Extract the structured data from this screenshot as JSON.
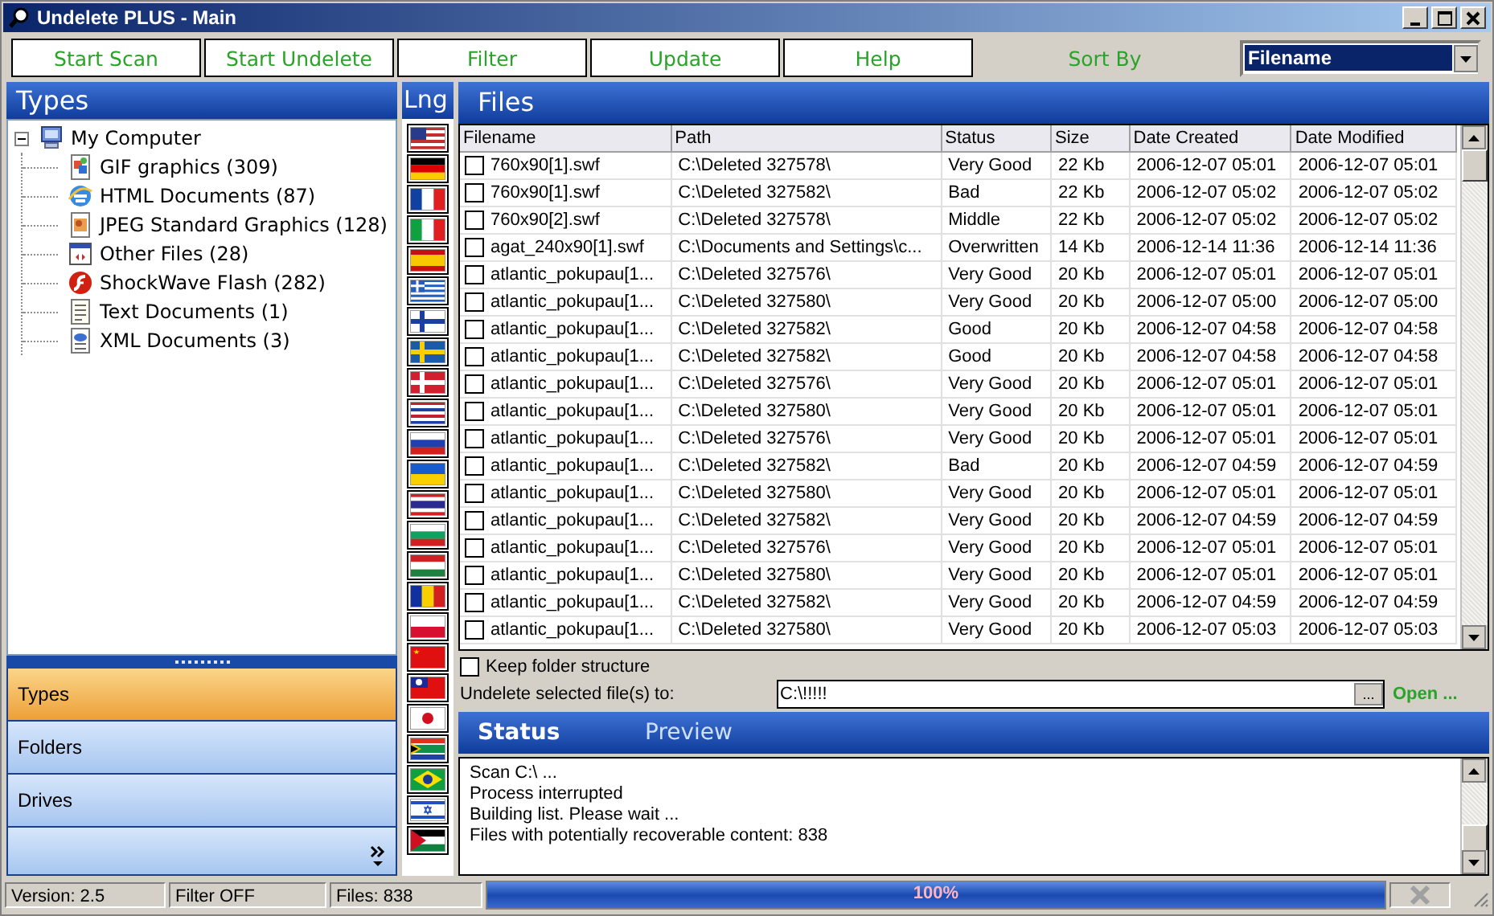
{
  "window": {
    "title": "Undelete PLUS - Main"
  },
  "toolbar": {
    "buttons": [
      "Start Scan",
      "Start Undelete",
      "Filter",
      "Update",
      "Help"
    ],
    "sort_label": "Sort By",
    "sort_value": "Filename"
  },
  "types_panel": {
    "title": "Types",
    "tree": [
      {
        "label": "My Computer",
        "kind": "computer",
        "expanded": true,
        "children": [
          {
            "label": "GIF graphics (309)",
            "kind": "gif"
          },
          {
            "label": "HTML Documents (87)",
            "kind": "html"
          },
          {
            "label": "JPEG Standard Graphics (128)",
            "kind": "jpeg"
          },
          {
            "label": "Other Files (28)",
            "kind": "other"
          },
          {
            "label": "ShockWave Flash (282)",
            "kind": "flash"
          },
          {
            "label": "Text Documents (1)",
            "kind": "text"
          },
          {
            "label": "XML Documents (3)",
            "kind": "xml"
          }
        ]
      }
    ]
  },
  "nav": [
    {
      "label": "Types",
      "selected": true
    },
    {
      "label": "Folders",
      "selected": false
    },
    {
      "label": "Drives",
      "selected": false
    }
  ],
  "languages": {
    "title": "Lng",
    "flags": [
      {
        "kind": "usa"
      },
      {
        "kind": "germany"
      },
      {
        "kind": "france"
      },
      {
        "kind": "italy"
      },
      {
        "kind": "spain"
      },
      {
        "kind": "greece"
      },
      {
        "kind": "finland"
      },
      {
        "kind": "sweden"
      },
      {
        "kind": "denmark"
      },
      {
        "kind": "netherlands"
      },
      {
        "kind": "russia"
      },
      {
        "kind": "ukraine"
      },
      {
        "kind": "thailand"
      },
      {
        "kind": "bulgaria"
      },
      {
        "kind": "hungary"
      },
      {
        "kind": "romania"
      },
      {
        "kind": "poland"
      },
      {
        "kind": "china"
      },
      {
        "kind": "taiwan"
      },
      {
        "kind": "japan"
      },
      {
        "kind": "southafrica"
      },
      {
        "kind": "brazil"
      },
      {
        "kind": "israel"
      },
      {
        "kind": "jordan"
      }
    ]
  },
  "files": {
    "title": "Files",
    "columns": [
      "Filename",
      "Path",
      "Status",
      "Size",
      "Date Created",
      "Date Modified"
    ],
    "rows": [
      {
        "checked": false,
        "cells": [
          "760x90[1].swf",
          "C:\\Deleted 327578\\",
          "Very Good",
          "22 Kb",
          "2006-12-07 05:01",
          "2006-12-07 05:01"
        ]
      },
      {
        "checked": false,
        "cells": [
          "760x90[1].swf",
          "C:\\Deleted 327582\\",
          "Bad",
          "22 Kb",
          "2006-12-07 05:02",
          "2006-12-07 05:02"
        ]
      },
      {
        "checked": false,
        "cells": [
          "760x90[2].swf",
          "C:\\Deleted 327578\\",
          "Middle",
          "22 Kb",
          "2006-12-07 05:02",
          "2006-12-07 05:02"
        ]
      },
      {
        "checked": false,
        "cells": [
          "agat_240x90[1].swf",
          "C:\\Documents and Settings\\c...",
          "Overwritten",
          "14 Kb",
          "2006-12-14 11:36",
          "2006-12-14 11:36"
        ]
      },
      {
        "checked": false,
        "cells": [
          "atlantic_pokupau[1...",
          "C:\\Deleted 327576\\",
          "Very Good",
          "20 Kb",
          "2006-12-07 05:01",
          "2006-12-07 05:01"
        ]
      },
      {
        "checked": false,
        "cells": [
          "atlantic_pokupau[1...",
          "C:\\Deleted 327580\\",
          "Very Good",
          "20 Kb",
          "2006-12-07 05:00",
          "2006-12-07 05:00"
        ]
      },
      {
        "checked": false,
        "cells": [
          "atlantic_pokupau[1...",
          "C:\\Deleted 327582\\",
          "Good",
          "20 Kb",
          "2006-12-07 04:58",
          "2006-12-07 04:58"
        ]
      },
      {
        "checked": false,
        "cells": [
          "atlantic_pokupau[1...",
          "C:\\Deleted 327582\\",
          "Good",
          "20 Kb",
          "2006-12-07 04:58",
          "2006-12-07 04:58"
        ]
      },
      {
        "checked": false,
        "cells": [
          "atlantic_pokupau[1...",
          "C:\\Deleted 327576\\",
          "Very Good",
          "20 Kb",
          "2006-12-07 05:01",
          "2006-12-07 05:01"
        ]
      },
      {
        "checked": false,
        "cells": [
          "atlantic_pokupau[1...",
          "C:\\Deleted 327580\\",
          "Very Good",
          "20 Kb",
          "2006-12-07 05:01",
          "2006-12-07 05:01"
        ]
      },
      {
        "checked": false,
        "cells": [
          "atlantic_pokupau[1...",
          "C:\\Deleted 327576\\",
          "Very Good",
          "20 Kb",
          "2006-12-07 05:01",
          "2006-12-07 05:01"
        ]
      },
      {
        "checked": false,
        "cells": [
          "atlantic_pokupau[1...",
          "C:\\Deleted 327582\\",
          "Bad",
          "20 Kb",
          "2006-12-07 04:59",
          "2006-12-07 04:59"
        ]
      },
      {
        "checked": false,
        "cells": [
          "atlantic_pokupau[1...",
          "C:\\Deleted 327580\\",
          "Very Good",
          "20 Kb",
          "2006-12-07 05:01",
          "2006-12-07 05:01"
        ]
      },
      {
        "checked": false,
        "cells": [
          "atlantic_pokupau[1...",
          "C:\\Deleted 327582\\",
          "Very Good",
          "20 Kb",
          "2006-12-07 04:59",
          "2006-12-07 04:59"
        ]
      },
      {
        "checked": false,
        "cells": [
          "atlantic_pokupau[1...",
          "C:\\Deleted 327576\\",
          "Very Good",
          "20 Kb",
          "2006-12-07 05:01",
          "2006-12-07 05:01"
        ]
      },
      {
        "checked": false,
        "cells": [
          "atlantic_pokupau[1...",
          "C:\\Deleted 327580\\",
          "Very Good",
          "20 Kb",
          "2006-12-07 05:01",
          "2006-12-07 05:01"
        ]
      },
      {
        "checked": false,
        "cells": [
          "atlantic_pokupau[1...",
          "C:\\Deleted 327582\\",
          "Very Good",
          "20 Kb",
          "2006-12-07 04:59",
          "2006-12-07 04:59"
        ]
      },
      {
        "checked": false,
        "cells": [
          "atlantic_pokupau[1...",
          "C:\\Deleted 327580\\",
          "Very Good",
          "20 Kb",
          "2006-12-07 05:03",
          "2006-12-07 05:03"
        ]
      }
    ]
  },
  "options": {
    "keep_folder": {
      "label": "Keep folder structure",
      "checked": false
    },
    "target_label": "Undelete selected file(s) to:",
    "target_value": "C:\\!!!!!",
    "browse": "...",
    "open": "Open ..."
  },
  "status": {
    "tabs": [
      {
        "label": "Status",
        "selected": true
      },
      {
        "label": "Preview",
        "selected": false
      }
    ],
    "log": [
      "Scan C:\\ ...",
      "Process interrupted",
      "Building list. Please wait ...",
      "Files with potentially recoverable content: 838"
    ]
  },
  "status_bar": {
    "version": "Version: 2.5",
    "filter": "Filter OFF",
    "files": "Files: 838",
    "progress": {
      "level": 1,
      "reading": "100%"
    }
  }
}
